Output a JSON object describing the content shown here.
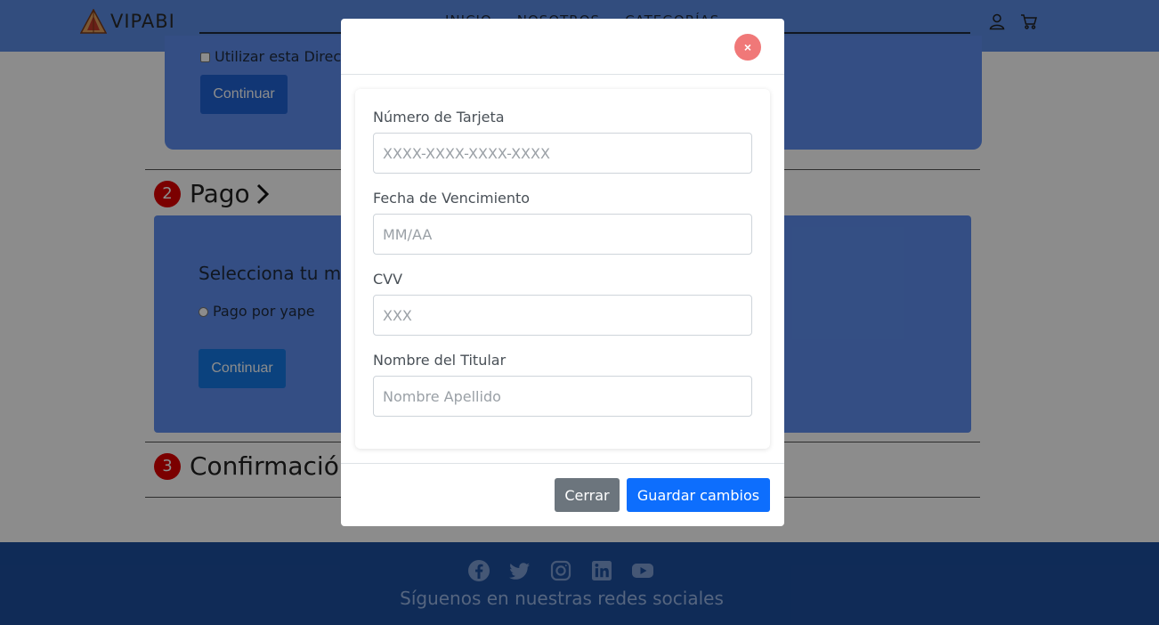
{
  "brand": {
    "name": "VIPABI",
    "logo": "vipabi-logo"
  },
  "nav": {
    "links": [
      "INICIO",
      "NOSOTROS",
      "CATEGORÍAS"
    ]
  },
  "address_section": {
    "use_address_label": "Utilizar esta Direcc",
    "continue_label": "Continuar"
  },
  "steps": [
    {
      "number": "2",
      "title": "Pago"
    },
    {
      "number": "3",
      "title": "Confirmación"
    }
  ],
  "payment": {
    "select_label": "Selecciona tu me",
    "option_yape": "Pago por yape",
    "continue_label": "Continuar"
  },
  "footer": {
    "follow_text": "Síguenos en nuestras redes sociales",
    "icons": [
      "facebook-icon",
      "twitter-icon",
      "instagram-icon",
      "linkedin-icon",
      "youtube-icon"
    ]
  },
  "modal": {
    "close_symbol": "×",
    "fields": [
      {
        "label": "Número de Tarjeta",
        "placeholder": "XXXX-XXXX-XXXX-XXXX"
      },
      {
        "label": "Fecha de Vencimiento",
        "placeholder": "MM/AA"
      },
      {
        "label": "CVV",
        "placeholder": "XXX"
      },
      {
        "label": "Nombre del Titular",
        "placeholder": "Nombre Apellido"
      }
    ],
    "cancel_label": "Cerrar",
    "save_label": "Guardar cambios"
  },
  "colors": {
    "navbar": "#5b8de6",
    "step_badge": "#e00000",
    "primary": "#0d6efd",
    "secondary": "#6c757d",
    "footer": "#1d4f9e"
  }
}
